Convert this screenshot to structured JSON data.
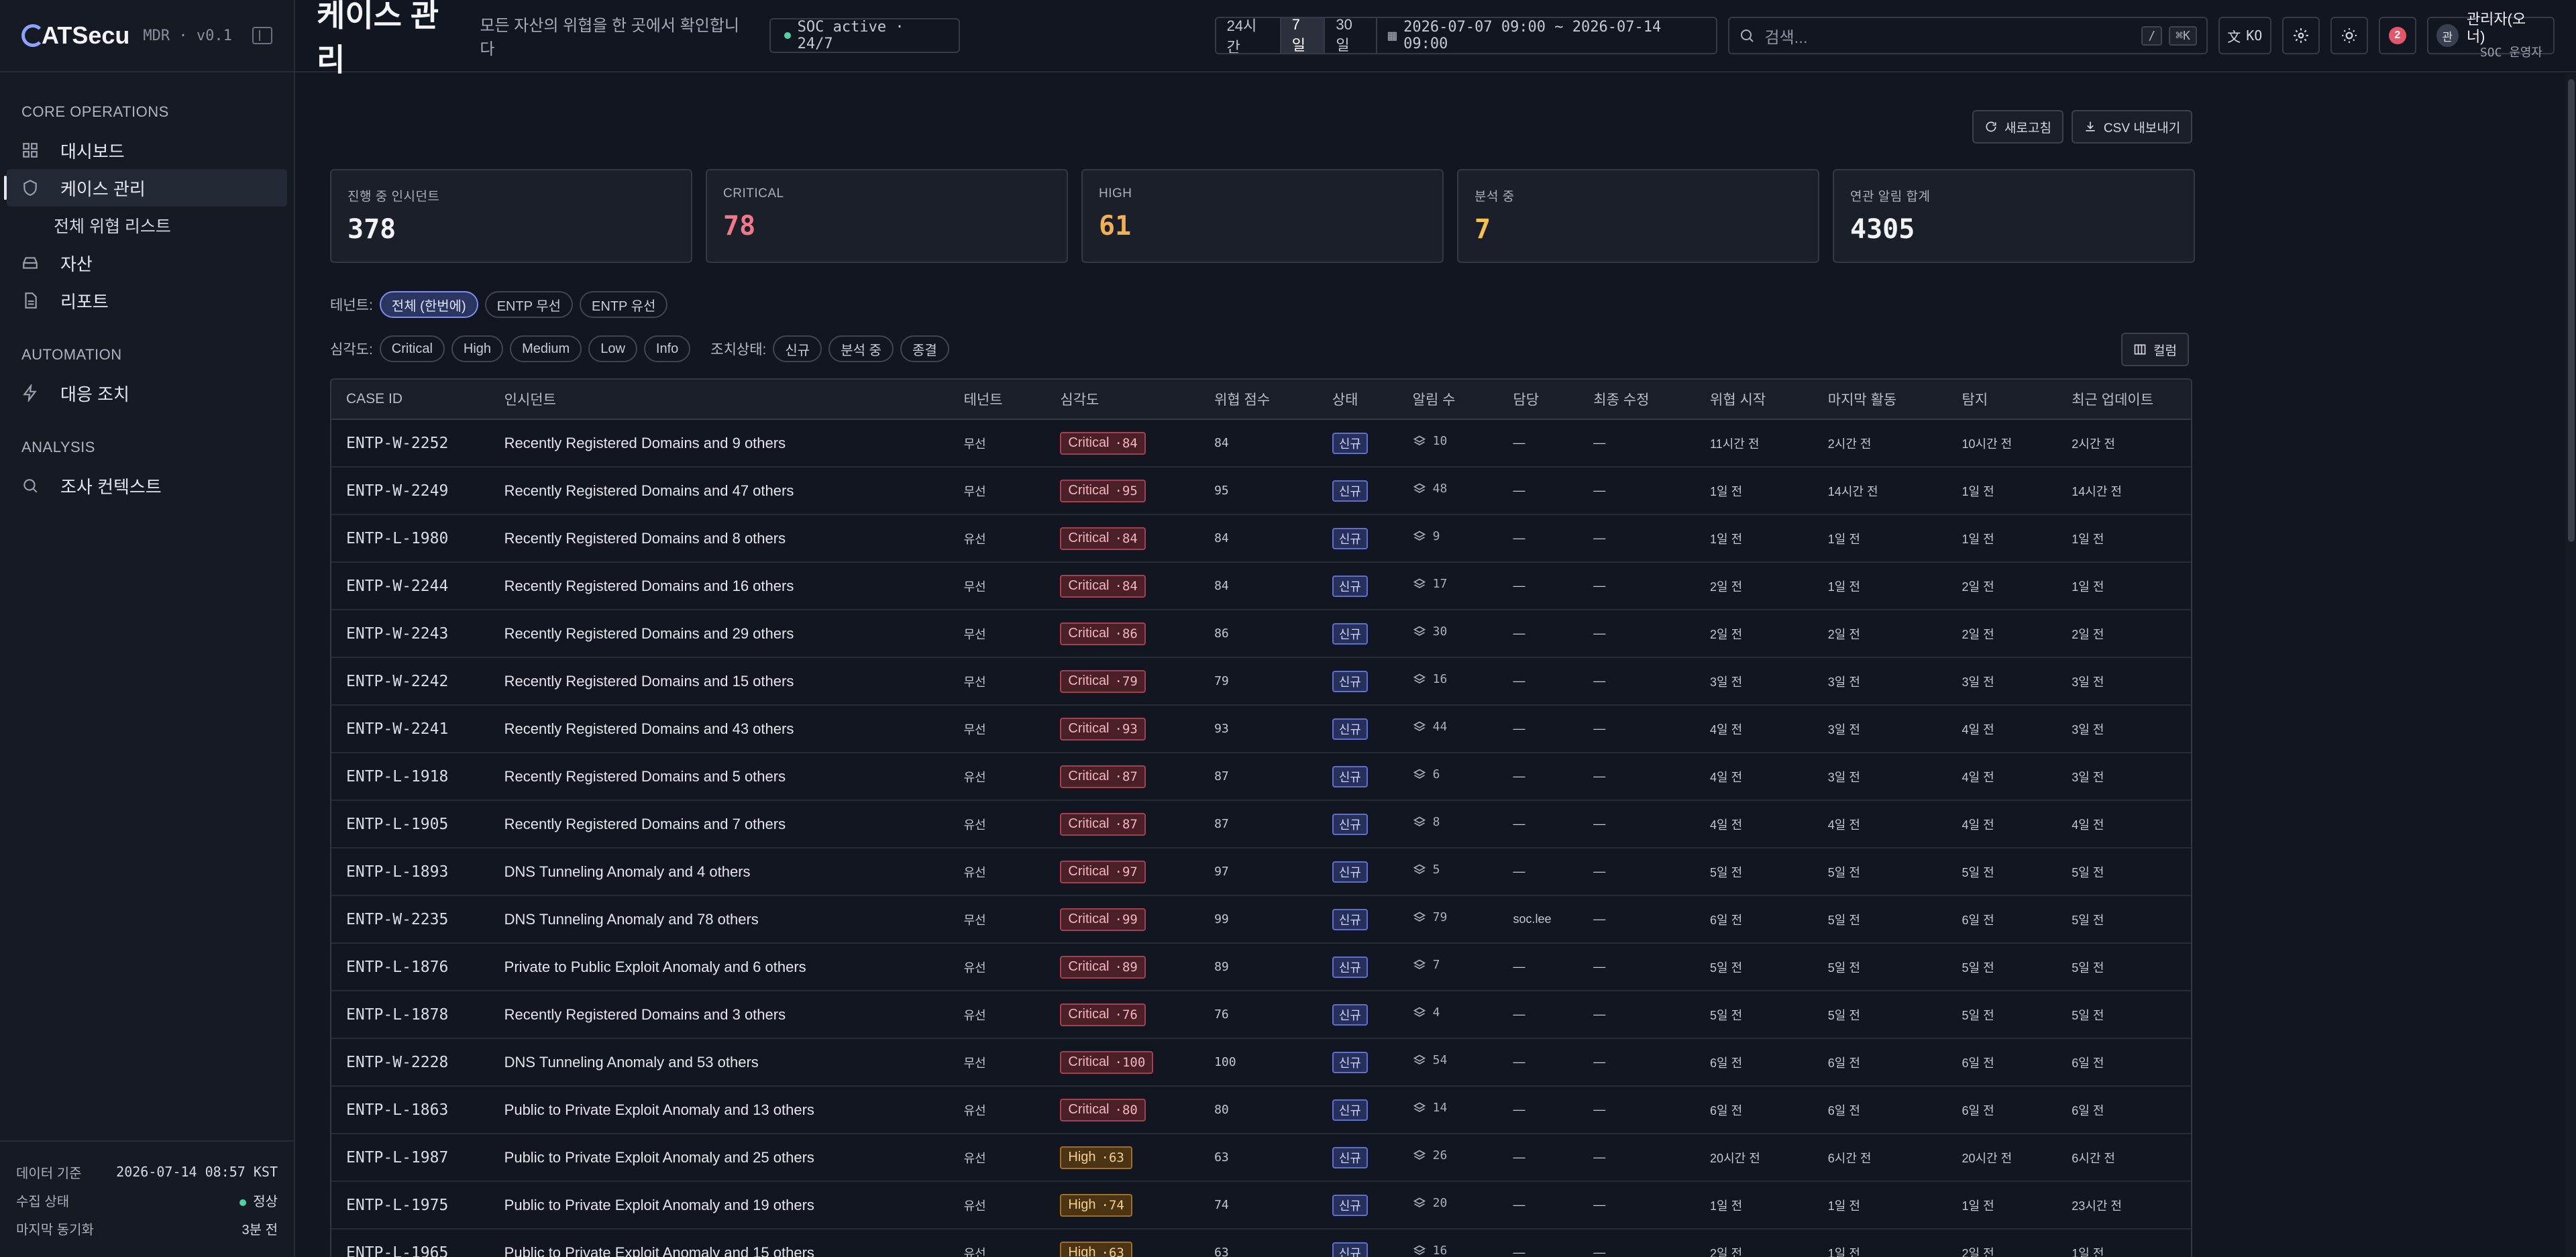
{
  "brand": {
    "name": "ATSecu",
    "version": "MDR · v0.1"
  },
  "sidebar": {
    "sections": [
      {
        "heading": "CORE OPERATIONS",
        "items": [
          {
            "label": "대시보드",
            "icon": "dashboard-icon"
          },
          {
            "label": "케이스 관리",
            "icon": "shield-icon",
            "active": true
          },
          {
            "label": "전체 위협 리스트",
            "sub": true
          },
          {
            "label": "자산",
            "icon": "asset-icon"
          },
          {
            "label": "리포트",
            "icon": "report-icon"
          }
        ]
      },
      {
        "heading": "AUTOMATION",
        "items": [
          {
            "label": "대응 조치",
            "icon": "bolt-icon"
          }
        ]
      },
      {
        "heading": "ANALYSIS",
        "items": [
          {
            "label": "조사 컨텍스트",
            "icon": "search-icon"
          }
        ]
      }
    ],
    "footer": {
      "data_basis_label": "데이터 기준",
      "data_basis_value": "2026-07-14 08:57 KST",
      "collect_label": "수집 상태",
      "collect_value": "정상",
      "sync_label": "마지막 동기화",
      "sync_value": "3분 전"
    }
  },
  "header": {
    "title": "케이스 관리",
    "subtitle": "모든 자산의 위협을 한 곳에서 확인합니다",
    "soc_status": "SOC active · 24/7",
    "range_24h": "24시간",
    "range_7d": "7일",
    "range_30d": "30일",
    "date_range": "2026-07-07 09:00 ~ 2026-07-14 09:00",
    "search_placeholder": "검색...",
    "kbd_slash": "/",
    "kbd_cmd": "⌘K",
    "lang": "KO",
    "notif_count": "2",
    "user_avatar": "관",
    "user_name": "관리자(오너)",
    "user_role": "SOC 운영자"
  },
  "actions": {
    "refresh": "새로고침",
    "export": "CSV 내보내기",
    "columns": "컬럼"
  },
  "stats": [
    {
      "label": "진행 중 인시던트",
      "value": "378"
    },
    {
      "label": "CRITICAL",
      "value": "78"
    },
    {
      "label": "HIGH",
      "value": "61"
    },
    {
      "label": "분석 중",
      "value": "7"
    },
    {
      "label": "연관 알림 합계",
      "value": "4305"
    }
  ],
  "filters": {
    "tenant_label": "테넌트:",
    "tenants": [
      "전체 (한번에)",
      "ENTP 무선",
      "ENTP 유선"
    ],
    "severity_label": "심각도:",
    "severities": [
      "Critical",
      "High",
      "Medium",
      "Low",
      "Info"
    ],
    "action_label": "조치상태:",
    "actions": [
      "신규",
      "분석 중",
      "종결"
    ]
  },
  "table": {
    "headers": [
      "CASE ID",
      "인시던트",
      "테넌트",
      "심각도",
      "위협 점수",
      "상태",
      "알림 수",
      "담당",
      "최종 수정",
      "위협 시작",
      "마지막 활동",
      "탐지",
      "최근 업데이트"
    ],
    "rows": [
      {
        "id": "ENTP-W-2252",
        "incident": "Recently Registered Domains and 9 others",
        "tenant": "무선",
        "sev": "Critical",
        "sevnum": "·84",
        "score": "84",
        "status": "신규",
        "alerts": "10",
        "owner": "—",
        "modified": "—",
        "start": "11시간 전",
        "last": "2시간 전",
        "detect": "10시간 전",
        "updated": "2시간 전"
      },
      {
        "id": "ENTP-W-2249",
        "incident": "Recently Registered Domains and 47 others",
        "tenant": "무선",
        "sev": "Critical",
        "sevnum": "·95",
        "score": "95",
        "status": "신규",
        "alerts": "48",
        "owner": "—",
        "modified": "—",
        "start": "1일 전",
        "last": "14시간 전",
        "detect": "1일 전",
        "updated": "14시간 전"
      },
      {
        "id": "ENTP-L-1980",
        "incident": "Recently Registered Domains and 8 others",
        "tenant": "유선",
        "sev": "Critical",
        "sevnum": "·84",
        "score": "84",
        "status": "신규",
        "alerts": "9",
        "owner": "—",
        "modified": "—",
        "start": "1일 전",
        "last": "1일 전",
        "detect": "1일 전",
        "updated": "1일 전"
      },
      {
        "id": "ENTP-W-2244",
        "incident": "Recently Registered Domains and 16 others",
        "tenant": "무선",
        "sev": "Critical",
        "sevnum": "·84",
        "score": "84",
        "status": "신규",
        "alerts": "17",
        "owner": "—",
        "modified": "—",
        "start": "2일 전",
        "last": "1일 전",
        "detect": "2일 전",
        "updated": "1일 전"
      },
      {
        "id": "ENTP-W-2243",
        "incident": "Recently Registered Domains and 29 others",
        "tenant": "무선",
        "sev": "Critical",
        "sevnum": "·86",
        "score": "86",
        "status": "신규",
        "alerts": "30",
        "owner": "—",
        "modified": "—",
        "start": "2일 전",
        "last": "2일 전",
        "detect": "2일 전",
        "updated": "2일 전"
      },
      {
        "id": "ENTP-W-2242",
        "incident": "Recently Registered Domains and 15 others",
        "tenant": "무선",
        "sev": "Critical",
        "sevnum": "·79",
        "score": "79",
        "status": "신규",
        "alerts": "16",
        "owner": "—",
        "modified": "—",
        "start": "3일 전",
        "last": "3일 전",
        "detect": "3일 전",
        "updated": "3일 전"
      },
      {
        "id": "ENTP-W-2241",
        "incident": "Recently Registered Domains and 43 others",
        "tenant": "무선",
        "sev": "Critical",
        "sevnum": "·93",
        "score": "93",
        "status": "신규",
        "alerts": "44",
        "owner": "—",
        "modified": "—",
        "start": "4일 전",
        "last": "3일 전",
        "detect": "4일 전",
        "updated": "3일 전"
      },
      {
        "id": "ENTP-L-1918",
        "incident": "Recently Registered Domains and 5 others",
        "tenant": "유선",
        "sev": "Critical",
        "sevnum": "·87",
        "score": "87",
        "status": "신규",
        "alerts": "6",
        "owner": "—",
        "modified": "—",
        "start": "4일 전",
        "last": "3일 전",
        "detect": "4일 전",
        "updated": "3일 전"
      },
      {
        "id": "ENTP-L-1905",
        "incident": "Recently Registered Domains and 7 others",
        "tenant": "유선",
        "sev": "Critical",
        "sevnum": "·87",
        "score": "87",
        "status": "신규",
        "alerts": "8",
        "owner": "—",
        "modified": "—",
        "start": "4일 전",
        "last": "4일 전",
        "detect": "4일 전",
        "updated": "4일 전"
      },
      {
        "id": "ENTP-L-1893",
        "incident": "DNS Tunneling Anomaly and 4 others",
        "tenant": "유선",
        "sev": "Critical",
        "sevnum": "·97",
        "score": "97",
        "status": "신규",
        "alerts": "5",
        "owner": "—",
        "modified": "—",
        "start": "5일 전",
        "last": "5일 전",
        "detect": "5일 전",
        "updated": "5일 전"
      },
      {
        "id": "ENTP-W-2235",
        "incident": "DNS Tunneling Anomaly and 78 others",
        "tenant": "무선",
        "sev": "Critical",
        "sevnum": "·99",
        "score": "99",
        "status": "신규",
        "alerts": "79",
        "owner": "soc.lee",
        "modified": "—",
        "start": "6일 전",
        "last": "5일 전",
        "detect": "6일 전",
        "updated": "5일 전"
      },
      {
        "id": "ENTP-L-1876",
        "incident": "Private to Public Exploit Anomaly and 6 others",
        "tenant": "유선",
        "sev": "Critical",
        "sevnum": "·89",
        "score": "89",
        "status": "신규",
        "alerts": "7",
        "owner": "—",
        "modified": "—",
        "start": "5일 전",
        "last": "5일 전",
        "detect": "5일 전",
        "updated": "5일 전"
      },
      {
        "id": "ENTP-L-1878",
        "incident": "Recently Registered Domains and 3 others",
        "tenant": "유선",
        "sev": "Critical",
        "sevnum": "·76",
        "score": "76",
        "status": "신규",
        "alerts": "4",
        "owner": "—",
        "modified": "—",
        "start": "5일 전",
        "last": "5일 전",
        "detect": "5일 전",
        "updated": "5일 전"
      },
      {
        "id": "ENTP-W-2228",
        "incident": "DNS Tunneling Anomaly and 53 others",
        "tenant": "무선",
        "sev": "Critical",
        "sevnum": "·100",
        "score": "100",
        "status": "신규",
        "alerts": "54",
        "owner": "—",
        "modified": "—",
        "start": "6일 전",
        "last": "6일 전",
        "detect": "6일 전",
        "updated": "6일 전"
      },
      {
        "id": "ENTP-L-1863",
        "incident": "Public to Private Exploit Anomaly and 13 others",
        "tenant": "유선",
        "sev": "Critical",
        "sevnum": "·80",
        "score": "80",
        "status": "신규",
        "alerts": "14",
        "owner": "—",
        "modified": "—",
        "start": "6일 전",
        "last": "6일 전",
        "detect": "6일 전",
        "updated": "6일 전"
      },
      {
        "id": "ENTP-L-1987",
        "incident": "Public to Private Exploit Anomaly and 25 others",
        "tenant": "유선",
        "sev": "High",
        "sevnum": "·63",
        "score": "63",
        "status": "신규",
        "alerts": "26",
        "owner": "—",
        "modified": "—",
        "start": "20시간 전",
        "last": "6시간 전",
        "detect": "20시간 전",
        "updated": "6시간 전"
      },
      {
        "id": "ENTP-L-1975",
        "incident": "Public to Private Exploit Anomaly and 19 others",
        "tenant": "유선",
        "sev": "High",
        "sevnum": "·74",
        "score": "74",
        "status": "신규",
        "alerts": "20",
        "owner": "—",
        "modified": "—",
        "start": "1일 전",
        "last": "1일 전",
        "detect": "1일 전",
        "updated": "23시간 전"
      },
      {
        "id": "ENTP-L-1965",
        "incident": "Public to Private Exploit Anomaly and 15 others",
        "tenant": "유선",
        "sev": "High",
        "sevnum": "·63",
        "score": "63",
        "status": "신규",
        "alerts": "16",
        "owner": "—",
        "modified": "—",
        "start": "2일 전",
        "last": "1일 전",
        "detect": "2일 전",
        "updated": "1일 전"
      }
    ]
  }
}
